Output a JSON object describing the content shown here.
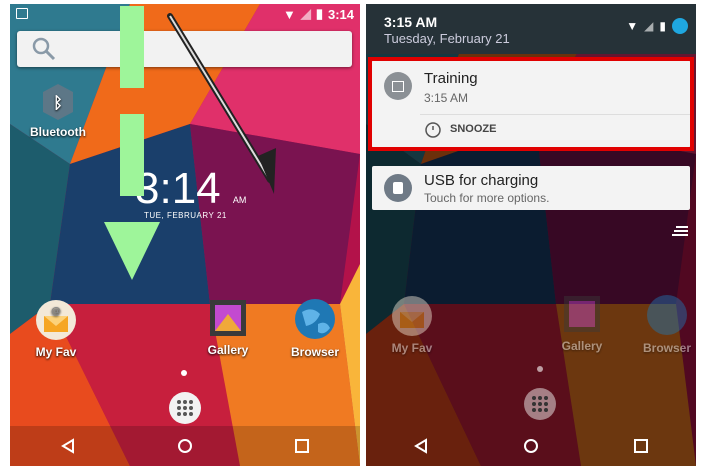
{
  "left": {
    "status_time": "3:14",
    "search_placeholder": "",
    "apps": {
      "bluetooth": "Bluetooth",
      "myfav": "My Fav",
      "gallery": "Gallery",
      "browser": "Browser"
    },
    "clock_time": "3:14",
    "clock_ampm": "AM",
    "clock_date": "TUE, FEBRUARY 21"
  },
  "right": {
    "header_time": "3:15 AM",
    "header_date": "Tuesday, February 21",
    "notif1": {
      "title": "Training",
      "sub": "3:15 AM",
      "action": "SNOOZE"
    },
    "notif2": {
      "title": "USB for charging",
      "sub": "Touch for more options."
    },
    "apps": {
      "myfav": "My Fav",
      "gallery": "Gallery",
      "browser": "Browser"
    }
  },
  "colors": {
    "highlight": "#e00000",
    "arrow": "#9ef59a",
    "shade": "#263238"
  }
}
